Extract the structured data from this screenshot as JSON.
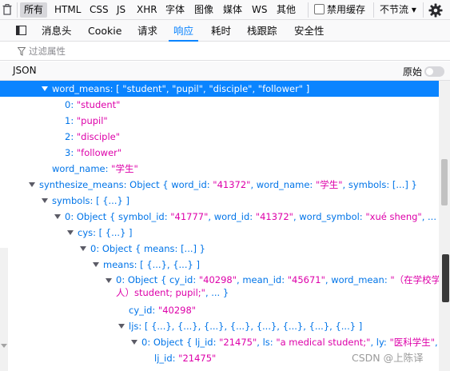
{
  "toolbar": {
    "filters": [
      "所有",
      "HTML",
      "CSS",
      "JS",
      "XHR",
      "字体",
      "图像",
      "媒体",
      "WS",
      "其他"
    ],
    "active_filter": "所有",
    "disable_cache_label": "禁用缓存",
    "disable_cache_checked": false,
    "throttle_label": "不节流 ▾"
  },
  "tabs": [
    "消息头",
    "Cookie",
    "请求",
    "响应",
    "耗时",
    "栈跟踪",
    "安全性"
  ],
  "selected_tab": "响应",
  "filter_placeholder": "过滤属性",
  "json_header": {
    "title": "JSON",
    "raw_label": "原始",
    "raw_enabled": false
  },
  "tree": {
    "word_means_line": {
      "key": "word_means:",
      "rest": "[ \"student\", \"pupil\", \"disciple\", \"follower\" ]"
    },
    "word_means_items": [
      {
        "key": "0:",
        "value": "\"student\""
      },
      {
        "key": "1:",
        "value": "\"pupil\""
      },
      {
        "key": "2:",
        "value": "\"disciple\""
      },
      {
        "key": "3:",
        "value": "\"follower\""
      }
    ],
    "word_name": {
      "key": "word_name:",
      "value": "\"学生\""
    },
    "synthesize_means": {
      "key": "synthesize_means:",
      "p1": "Object { word_id: ",
      "v1": "\"41372\"",
      "p2": ", word_name: ",
      "v2": "\"学生\"",
      "p3": ", symbols: [...] }"
    },
    "symbols": {
      "key": "symbols:",
      "rest": "[ {...} ]"
    },
    "symbol0": {
      "key": "0:",
      "p1": "Object { symbol_id: ",
      "v1": "\"41777\"",
      "p2": ", word_id: ",
      "v2": "\"41372\"",
      "p3": ", word_symbol: ",
      "v3": "\"xué sheng\"",
      "p4": ", ... }"
    },
    "cys": {
      "key": "cys:",
      "rest": "[ {...} ]"
    },
    "cys0": {
      "key": "0:",
      "rest": "Object { means: [...] }"
    },
    "means": {
      "key": "means:",
      "rest": "[ {...}, {...} ]"
    },
    "means0": {
      "key": "0:",
      "p1": "Object { cy_id: ",
      "v1": "\"40298\"",
      "p2": ", mean_id: ",
      "v2": "\"45671\"",
      "p3": ", word_mean: ",
      "v3a": "\"（在学校学习的",
      "v3b": "人）student; pupil;\"",
      "p4": ", ... }"
    },
    "cy_id": {
      "key": "cy_id:",
      "value": "\"40298\""
    },
    "ljs": {
      "key": "ljs:",
      "rest": "[ {...}, {...}, {...}, {...}, {...}, {...}, {...}, {...} ]"
    },
    "ljs0": {
      "key": "0:",
      "p1": "Object { lj_id: ",
      "v1": "\"21475\"",
      "p2": ", ls: ",
      "v2": "\"a medical student;\"",
      "p3": ", ly: ",
      "v3": "\"医科学生\"",
      "p4": ", ... }"
    },
    "lj_id": {
      "key": "lj_id:",
      "value": "\"21475\""
    }
  },
  "watermark": "CSDN @上陈译",
  "colors": {
    "accent": "#0a84ff",
    "key": "#0074e8",
    "string": "#dd00a9",
    "selected_row": "#0a84ff"
  },
  "icons": [
    "trash-icon",
    "gear-icon",
    "panel-toggle-icon",
    "funnel-icon"
  ]
}
